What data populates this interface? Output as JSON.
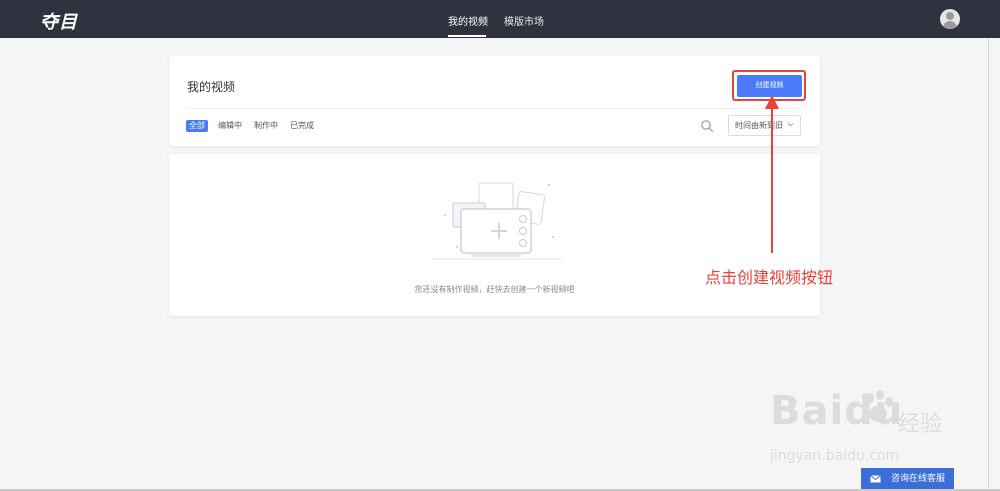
{
  "app": {
    "logo_text": "夺目"
  },
  "nav": {
    "tabs": [
      {
        "label": "我的视频",
        "active": true
      },
      {
        "label": "模版市场",
        "active": false
      }
    ]
  },
  "header": {
    "title": "我的视频",
    "create_button_label": "创建视频",
    "filters": [
      {
        "label": "全部",
        "active": true
      },
      {
        "label": "编辑中",
        "active": false
      },
      {
        "label": "制作中",
        "active": false
      },
      {
        "label": "已完成",
        "active": false
      }
    ],
    "sort_value": "时间由新到旧"
  },
  "empty_state": {
    "message": "您还没有制作视频，赶快去创建一个新视频吧"
  },
  "annotation": {
    "text": "点击创建视频按钮",
    "color": "#e8423a"
  },
  "watermark": {
    "brand": "Baidu",
    "brand_cn": "经验",
    "url": "jingyan.baidu.com"
  },
  "service_widget": {
    "label": "咨询在线客服"
  },
  "colors": {
    "topbar": "#2f3340",
    "accent": "#4b7bfa",
    "service": "#3c6ed9"
  },
  "icons": [
    "user-avatar-icon",
    "search-icon",
    "chevron-down-icon",
    "empty-video-illustration",
    "mail-icon",
    "arrow-up-icon"
  ]
}
